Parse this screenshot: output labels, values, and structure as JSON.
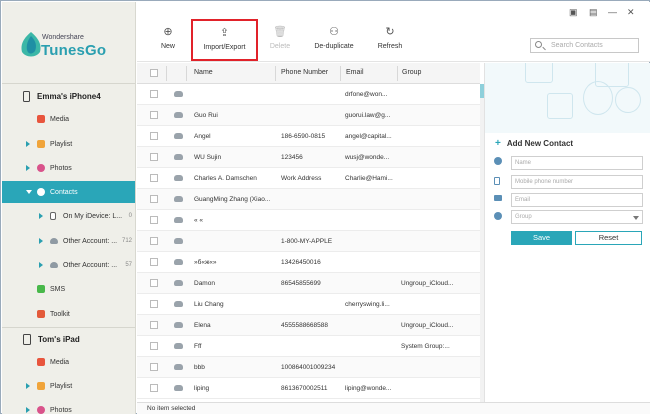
{
  "app": {
    "brand_small": "Wondershare",
    "brand_big": "TunesGo",
    "accent": "#2aa6b8"
  },
  "window_controls": [
    "▣",
    "▤",
    "—",
    "✕"
  ],
  "toolbar": {
    "new": "New",
    "import_export": "Import/Export",
    "delete": "Delete",
    "deduplicate": "De-duplicate",
    "refresh": "Refresh",
    "search_placeholder": "Search Contacts"
  },
  "sidebar": {
    "device1": "Emma's iPhone4",
    "device2": "Tom's iPad",
    "items1": [
      {
        "label": "Media",
        "icon": "media-icon",
        "color": "#e8553d"
      },
      {
        "label": "Playlist",
        "icon": "playlist-icon",
        "color": "#f0a43a"
      },
      {
        "label": "Photos",
        "icon": "photos-icon",
        "color": "#d9538b"
      },
      {
        "label": "Contacts",
        "icon": "contacts-icon",
        "color": "#ffffff"
      },
      {
        "label": "On My iDevice: L...",
        "count": "0",
        "icon": "device-icon",
        "color": "#777777"
      },
      {
        "label": "Other Account: ...",
        "count": "712",
        "icon": "cloud-icon",
        "color": "#8f9aa3"
      },
      {
        "label": "Other Account: ...",
        "count": "57",
        "icon": "cloud-icon",
        "color": "#8f9aa3"
      },
      {
        "label": "SMS",
        "icon": "sms-icon",
        "color": "#48b84a"
      },
      {
        "label": "Toolkit",
        "icon": "toolkit-icon",
        "color": "#e35a3a"
      }
    ],
    "items2": [
      {
        "label": "Media",
        "icon": "media-icon",
        "color": "#e8553d"
      },
      {
        "label": "Playlist",
        "icon": "playlist-icon",
        "color": "#f0a43a"
      },
      {
        "label": "Photos",
        "icon": "photos-icon",
        "color": "#d9538b"
      }
    ]
  },
  "table": {
    "headers": {
      "name": "Name",
      "phone": "Phone Number",
      "email": "Email",
      "group": "Group"
    },
    "rows": [
      {
        "name": "",
        "phone": "",
        "email": "drfone@won...",
        "group": ""
      },
      {
        "name": "Guo Rui",
        "phone": "",
        "email": "guorui.law@g...",
        "group": ""
      },
      {
        "name": "Angel",
        "phone": "186-6590-0815",
        "email": "angel@capital...",
        "group": ""
      },
      {
        "name": "WU  Sujin",
        "phone": "123456",
        "email": "wusj@wonde...",
        "group": ""
      },
      {
        "name": "Charles A. Damschen",
        "phone": "Work Address",
        "email": "Charlie@Hami...",
        "group": ""
      },
      {
        "name": "GuangMing  Zhang (Xiao...",
        "phone": "",
        "email": "",
        "group": ""
      },
      {
        "name": "« «",
        "phone": "",
        "email": "",
        "group": ""
      },
      {
        "name": "",
        "phone": "1-800-MY-APPLE",
        "email": "",
        "group": ""
      },
      {
        "name": "»б«ж«»",
        "phone": "13426450016",
        "email": "",
        "group": ""
      },
      {
        "name": "Damon",
        "phone": "86545855699",
        "email": "",
        "group": "Ungroup_iCloud..."
      },
      {
        "name": "Liu Chang",
        "phone": "",
        "email": "cherryswing.li...",
        "group": ""
      },
      {
        "name": "Elena",
        "phone": "4555588668588",
        "email": "",
        "group": "Ungroup_iCloud..."
      },
      {
        "name": "Fff",
        "phone": "",
        "email": "",
        "group": "System Group:..."
      },
      {
        "name": "bbb",
        "phone": "100864001009234",
        "email": "",
        "group": ""
      },
      {
        "name": "liping",
        "phone": "8613670002511",
        "email": "liping@wonde...",
        "group": ""
      }
    ]
  },
  "status": "No item selected",
  "new_contact": {
    "title": "Add New Contact",
    "name_ph": "Name",
    "phone_ph": "Mobile phone number",
    "email_ph": "Email",
    "group_ph": "Group",
    "save": "Save",
    "reset": "Reset"
  }
}
